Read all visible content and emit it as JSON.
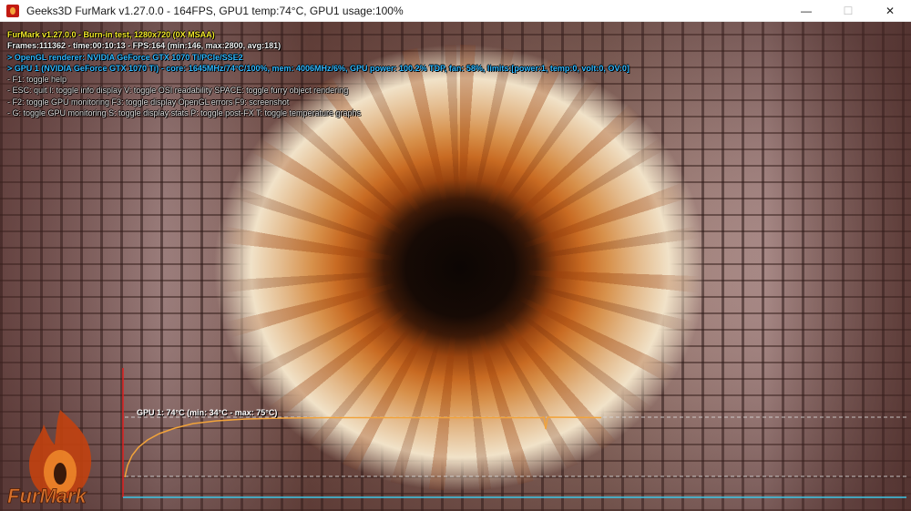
{
  "window": {
    "title": "Geeks3D FurMark v1.27.0.0 - 164FPS, GPU1 temp:74°C, GPU1 usage:100%",
    "controls": {
      "minimize": "—",
      "maximize": "☐",
      "close": "✕"
    }
  },
  "osd": {
    "header": "FurMark v1.27.0.0 - Burn-in test, 1280x720 (0X MSAA)",
    "frames": "Frames:111362 - time:00:10:13 - FPS:164 (min:146, max:2800, avg:181)",
    "renderer": "> OpenGL renderer: NVIDIA GeForce GTX 1070 Ti/PCIe/SSE2",
    "gpu": "> GPU 1 (NVIDIA GeForce GTX 1070 Ti) - core: 1645MHz/74°C/100%, mem: 4006MHz/6%, GPU power: 100.2% TDP, fan: 58%, limits:[power:1, temp:0, volt:0, OV:0]",
    "help_lines": [
      "- F1: toggle help",
      "- ESC: quit   I: toggle info display   V: toggle OSI readability   SPACE: toggle furry object rendering",
      "- F2: toggle GPU monitoring   F3: toggle display OpenGL errors   F9: screenshot",
      "- G: toggle GPU monitoring    S: toggle display stats   P: toggle post-FX   T: toggle temperature graphs"
    ]
  },
  "graph": {
    "label": "GPU 1: 74°C (min: 34°C - max: 75°C)",
    "current_temp_c": 74,
    "min_temp_c": 34,
    "max_temp_c": 75,
    "colors": {
      "curve": "#f2a33a",
      "axis_x": "#3cc6e6",
      "axis_y": "#e02020",
      "guide": "#d8d8d8"
    }
  },
  "logo": {
    "text": "FurMark"
  }
}
